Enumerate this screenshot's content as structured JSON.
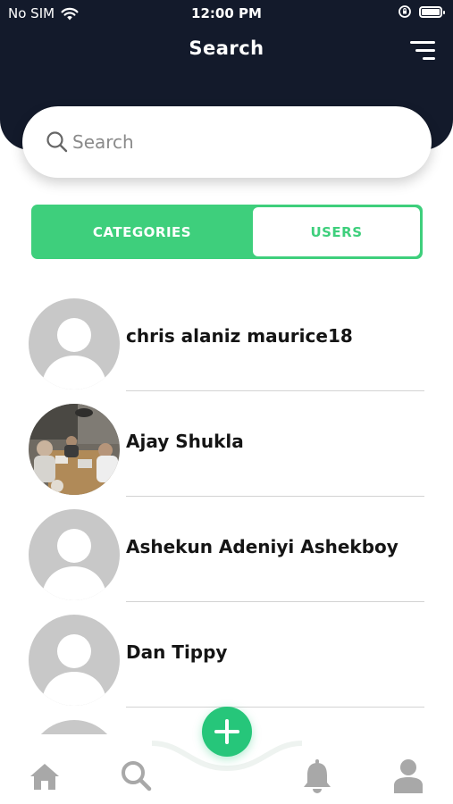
{
  "status_bar": {
    "carrier": "No SIM",
    "time": "12:00 PM",
    "battery_level": 1.0
  },
  "header": {
    "title": "Search",
    "menu_icon": "filter-lines-icon"
  },
  "search": {
    "placeholder": "Search",
    "value": "",
    "icon": "search-icon"
  },
  "segment": {
    "categories_label": "CATEGORIES",
    "users_label": "USERS",
    "selected": "USERS"
  },
  "users": [
    {
      "name": "chris alaniz maurice18",
      "avatar": "default-avatar"
    },
    {
      "name": "Ajay Shukla",
      "avatar": "photo-avatar"
    },
    {
      "name": "Ashekun Adeniyi Ashekboy",
      "avatar": "default-avatar"
    },
    {
      "name": "Dan Tippy",
      "avatar": "default-avatar"
    }
  ],
  "tab_bar": {
    "items": [
      "home-icon",
      "search-icon",
      "add-icon",
      "bell-icon",
      "user-icon"
    ]
  },
  "colors": {
    "header_bg": "#131a2b",
    "accent": "#3ecf7c",
    "fab": "#26c67a",
    "icon_gray": "#a8a8a8"
  }
}
